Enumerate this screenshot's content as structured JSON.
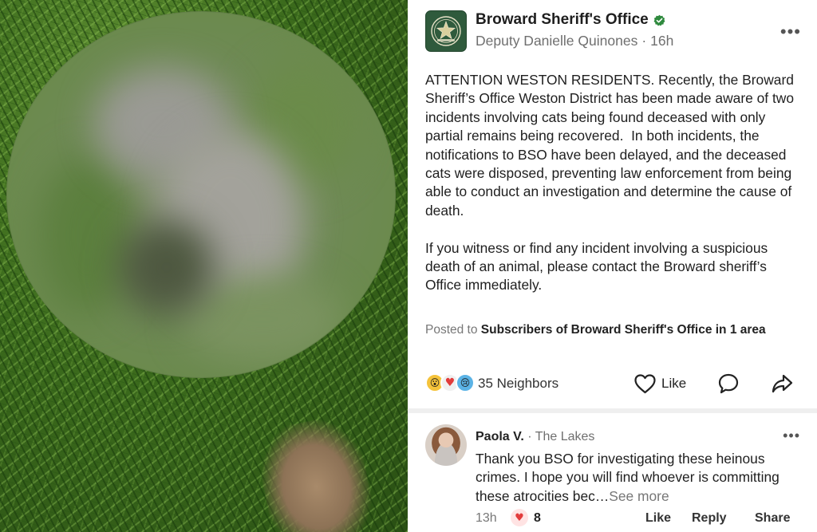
{
  "photo": {
    "description_icon": "blurred-photo"
  },
  "post": {
    "author": "Broward Sheriff's Office",
    "verified_icon": "verified-check-icon",
    "byline_person": "Deputy Danielle Quinones",
    "byline_separator": "·",
    "timestamp": "16h",
    "more_label": "•••",
    "body": "ATTENTION WESTON RESIDENTS. Recently, the Broward Sheriff’s Office Weston District has been made aware of two incidents involving cats being found deceased with only partial remains being recovered.  In both incidents, the notifications to BSO have been delayed, and the deceased cats were disposed, preventing law enforcement from being able to conduct an investigation and determine the cause of death.\n\nIf you witness or find any incident involving a suspicious death of an animal, please contact the Broward sheriff’s Office immediately.",
    "posted_to_prefix": "Posted to ",
    "posted_to_audience": "Subscribers of Broward Sheriff's Office in 1 area",
    "reactions_count": "35 Neighbors",
    "like_label": "Like",
    "accent_color": "#2f5a3c"
  },
  "comment": {
    "name": "Paola V.",
    "separator": " · ",
    "place": "The Lakes",
    "more_label": "•••",
    "text": "Thank you BSO for investigating these heinous crimes. I hope you will find whoever is committing these atrocities bec…",
    "see_more": "See more",
    "time": "13h",
    "heart_count": "8",
    "like_label": "Like",
    "reply_label": "Reply",
    "share_label": "Share"
  }
}
